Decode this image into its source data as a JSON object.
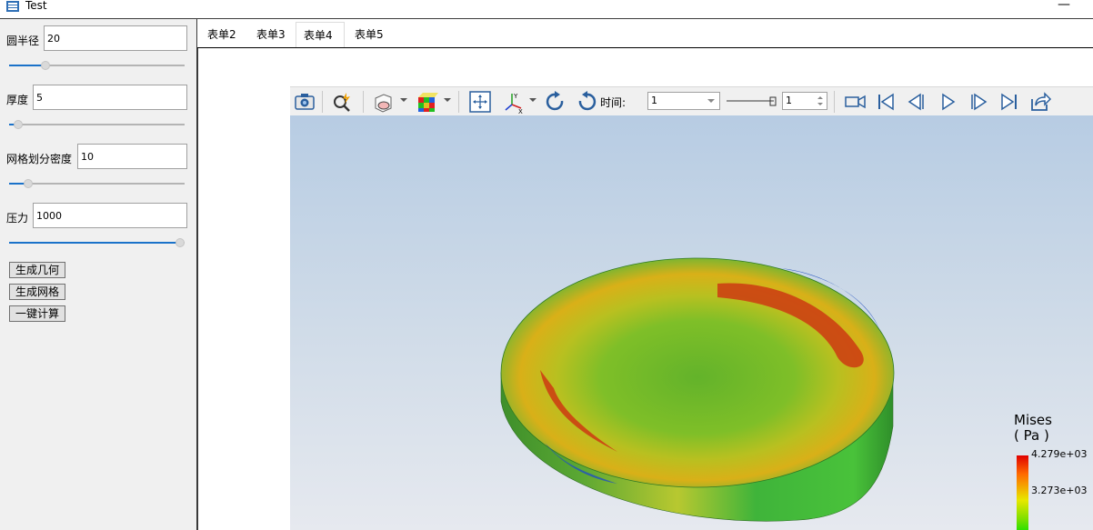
{
  "window": {
    "title": "Test",
    "minimize_glyph": "—"
  },
  "params": {
    "radius": {
      "label": "圆半径",
      "value": "20",
      "level": 0.19
    },
    "thickness": {
      "label": "厚度",
      "value": "5",
      "level": 0.03
    },
    "mesh": {
      "label": "网格划分密度",
      "value": "10",
      "level": 0.09
    },
    "pressure": {
      "label": "压力",
      "value": "1000",
      "level": 1.0
    }
  },
  "buttons": {
    "gen_geometry": "生成几何",
    "gen_mesh": "生成网格",
    "compute": "一键计算"
  },
  "tabs": [
    {
      "label": "表单2",
      "active": false
    },
    {
      "label": "表单3",
      "active": false
    },
    {
      "label": "表单4",
      "active": true
    },
    {
      "label": "表单5",
      "active": false
    }
  ],
  "toolbar": {
    "time_label": "时间:",
    "time_value": "1",
    "frame_value": "1",
    "icons": [
      "camera-icon",
      "magnify-icon",
      "display-mode-icon",
      "color-cube-icon",
      "fit-view-icon",
      "axes-icon",
      "rotate-cw-icon",
      "rotate-ccw-icon",
      "record-icon",
      "first-frame-icon",
      "prev-frame-icon",
      "play-icon",
      "next-frame-icon",
      "last-frame-icon",
      "export-icon"
    ]
  },
  "legend": {
    "title_line1": "Mises",
    "title_line2": "( Pa )",
    "max": "4.279e+03",
    "mid": "3.273e+03"
  },
  "colors": {
    "accent": "#1a72c9",
    "viewport_top": "#b7cce3",
    "viewport_bottom": "#e6e9ef"
  }
}
